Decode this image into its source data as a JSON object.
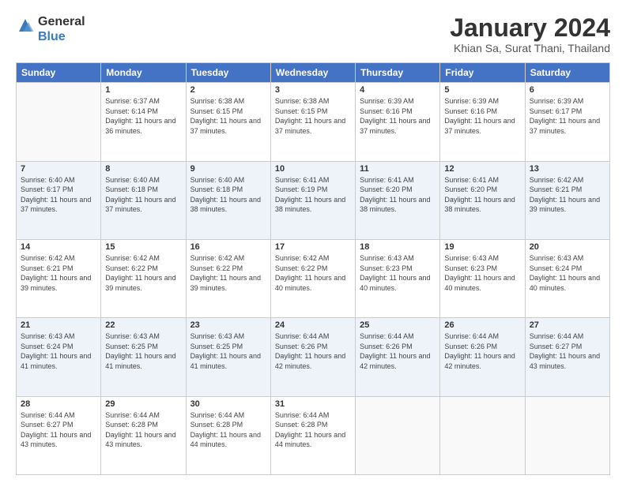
{
  "logo": {
    "general": "General",
    "blue": "Blue"
  },
  "header": {
    "month_year": "January 2024",
    "location": "Khian Sa, Surat Thani, Thailand"
  },
  "weekdays": [
    "Sunday",
    "Monday",
    "Tuesday",
    "Wednesday",
    "Thursday",
    "Friday",
    "Saturday"
  ],
  "weeks": [
    [
      {
        "day": "",
        "sunrise": "",
        "sunset": "",
        "daylight": ""
      },
      {
        "day": "1",
        "sunrise": "Sunrise: 6:37 AM",
        "sunset": "Sunset: 6:14 PM",
        "daylight": "Daylight: 11 hours and 36 minutes."
      },
      {
        "day": "2",
        "sunrise": "Sunrise: 6:38 AM",
        "sunset": "Sunset: 6:15 PM",
        "daylight": "Daylight: 11 hours and 37 minutes."
      },
      {
        "day": "3",
        "sunrise": "Sunrise: 6:38 AM",
        "sunset": "Sunset: 6:15 PM",
        "daylight": "Daylight: 11 hours and 37 minutes."
      },
      {
        "day": "4",
        "sunrise": "Sunrise: 6:39 AM",
        "sunset": "Sunset: 6:16 PM",
        "daylight": "Daylight: 11 hours and 37 minutes."
      },
      {
        "day": "5",
        "sunrise": "Sunrise: 6:39 AM",
        "sunset": "Sunset: 6:16 PM",
        "daylight": "Daylight: 11 hours and 37 minutes."
      },
      {
        "day": "6",
        "sunrise": "Sunrise: 6:39 AM",
        "sunset": "Sunset: 6:17 PM",
        "daylight": "Daylight: 11 hours and 37 minutes."
      }
    ],
    [
      {
        "day": "7",
        "sunrise": "Sunrise: 6:40 AM",
        "sunset": "Sunset: 6:17 PM",
        "daylight": "Daylight: 11 hours and 37 minutes."
      },
      {
        "day": "8",
        "sunrise": "Sunrise: 6:40 AM",
        "sunset": "Sunset: 6:18 PM",
        "daylight": "Daylight: 11 hours and 37 minutes."
      },
      {
        "day": "9",
        "sunrise": "Sunrise: 6:40 AM",
        "sunset": "Sunset: 6:18 PM",
        "daylight": "Daylight: 11 hours and 38 minutes."
      },
      {
        "day": "10",
        "sunrise": "Sunrise: 6:41 AM",
        "sunset": "Sunset: 6:19 PM",
        "daylight": "Daylight: 11 hours and 38 minutes."
      },
      {
        "day": "11",
        "sunrise": "Sunrise: 6:41 AM",
        "sunset": "Sunset: 6:20 PM",
        "daylight": "Daylight: 11 hours and 38 minutes."
      },
      {
        "day": "12",
        "sunrise": "Sunrise: 6:41 AM",
        "sunset": "Sunset: 6:20 PM",
        "daylight": "Daylight: 11 hours and 38 minutes."
      },
      {
        "day": "13",
        "sunrise": "Sunrise: 6:42 AM",
        "sunset": "Sunset: 6:21 PM",
        "daylight": "Daylight: 11 hours and 39 minutes."
      }
    ],
    [
      {
        "day": "14",
        "sunrise": "Sunrise: 6:42 AM",
        "sunset": "Sunset: 6:21 PM",
        "daylight": "Daylight: 11 hours and 39 minutes."
      },
      {
        "day": "15",
        "sunrise": "Sunrise: 6:42 AM",
        "sunset": "Sunset: 6:22 PM",
        "daylight": "Daylight: 11 hours and 39 minutes."
      },
      {
        "day": "16",
        "sunrise": "Sunrise: 6:42 AM",
        "sunset": "Sunset: 6:22 PM",
        "daylight": "Daylight: 11 hours and 39 minutes."
      },
      {
        "day": "17",
        "sunrise": "Sunrise: 6:42 AM",
        "sunset": "Sunset: 6:22 PM",
        "daylight": "Daylight: 11 hours and 40 minutes."
      },
      {
        "day": "18",
        "sunrise": "Sunrise: 6:43 AM",
        "sunset": "Sunset: 6:23 PM",
        "daylight": "Daylight: 11 hours and 40 minutes."
      },
      {
        "day": "19",
        "sunrise": "Sunrise: 6:43 AM",
        "sunset": "Sunset: 6:23 PM",
        "daylight": "Daylight: 11 hours and 40 minutes."
      },
      {
        "day": "20",
        "sunrise": "Sunrise: 6:43 AM",
        "sunset": "Sunset: 6:24 PM",
        "daylight": "Daylight: 11 hours and 40 minutes."
      }
    ],
    [
      {
        "day": "21",
        "sunrise": "Sunrise: 6:43 AM",
        "sunset": "Sunset: 6:24 PM",
        "daylight": "Daylight: 11 hours and 41 minutes."
      },
      {
        "day": "22",
        "sunrise": "Sunrise: 6:43 AM",
        "sunset": "Sunset: 6:25 PM",
        "daylight": "Daylight: 11 hours and 41 minutes."
      },
      {
        "day": "23",
        "sunrise": "Sunrise: 6:43 AM",
        "sunset": "Sunset: 6:25 PM",
        "daylight": "Daylight: 11 hours and 41 minutes."
      },
      {
        "day": "24",
        "sunrise": "Sunrise: 6:44 AM",
        "sunset": "Sunset: 6:26 PM",
        "daylight": "Daylight: 11 hours and 42 minutes."
      },
      {
        "day": "25",
        "sunrise": "Sunrise: 6:44 AM",
        "sunset": "Sunset: 6:26 PM",
        "daylight": "Daylight: 11 hours and 42 minutes."
      },
      {
        "day": "26",
        "sunrise": "Sunrise: 6:44 AM",
        "sunset": "Sunset: 6:26 PM",
        "daylight": "Daylight: 11 hours and 42 minutes."
      },
      {
        "day": "27",
        "sunrise": "Sunrise: 6:44 AM",
        "sunset": "Sunset: 6:27 PM",
        "daylight": "Daylight: 11 hours and 43 minutes."
      }
    ],
    [
      {
        "day": "28",
        "sunrise": "Sunrise: 6:44 AM",
        "sunset": "Sunset: 6:27 PM",
        "daylight": "Daylight: 11 hours and 43 minutes."
      },
      {
        "day": "29",
        "sunrise": "Sunrise: 6:44 AM",
        "sunset": "Sunset: 6:28 PM",
        "daylight": "Daylight: 11 hours and 43 minutes."
      },
      {
        "day": "30",
        "sunrise": "Sunrise: 6:44 AM",
        "sunset": "Sunset: 6:28 PM",
        "daylight": "Daylight: 11 hours and 44 minutes."
      },
      {
        "day": "31",
        "sunrise": "Sunrise: 6:44 AM",
        "sunset": "Sunset: 6:28 PM",
        "daylight": "Daylight: 11 hours and 44 minutes."
      },
      {
        "day": "",
        "sunrise": "",
        "sunset": "",
        "daylight": ""
      },
      {
        "day": "",
        "sunrise": "",
        "sunset": "",
        "daylight": ""
      },
      {
        "day": "",
        "sunrise": "",
        "sunset": "",
        "daylight": ""
      }
    ]
  ]
}
